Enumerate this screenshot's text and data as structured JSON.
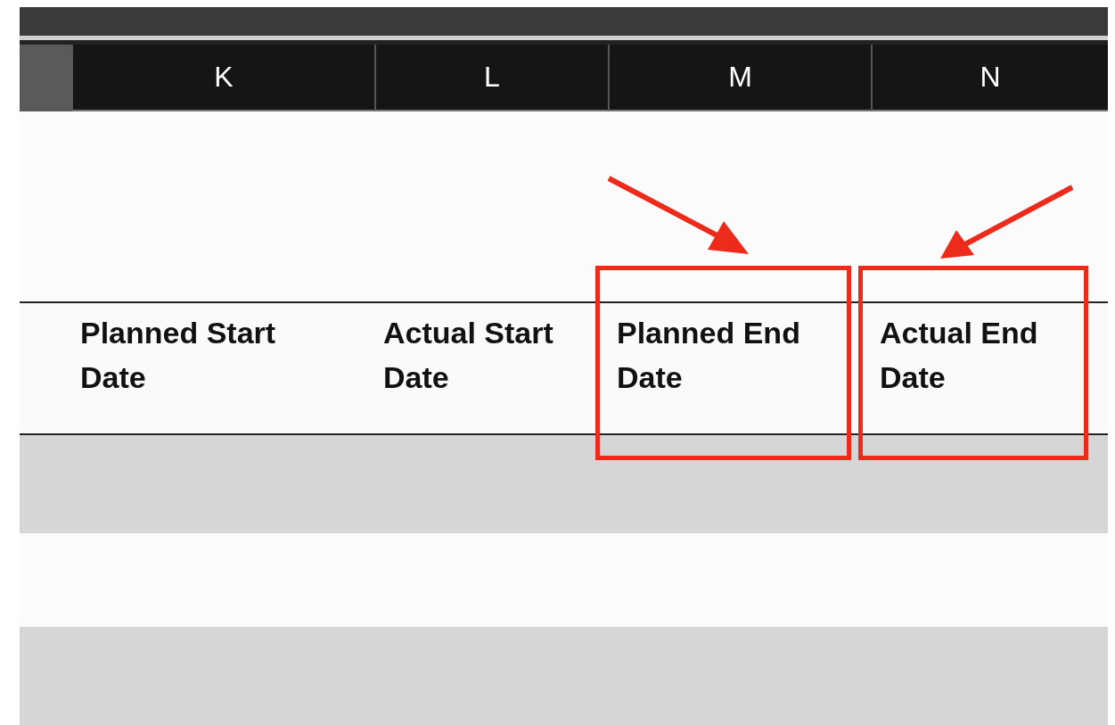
{
  "columns": [
    {
      "letter": "K",
      "header": "Planned Start Date",
      "kind": "plain"
    },
    {
      "letter": "L",
      "header": "Actual Start Date",
      "kind": "plain"
    },
    {
      "letter": "M",
      "header": "Planned End Date",
      "kind": "marked-left"
    },
    {
      "letter": "N",
      "header": "Actual End Date",
      "kind": "marked-right"
    }
  ]
}
